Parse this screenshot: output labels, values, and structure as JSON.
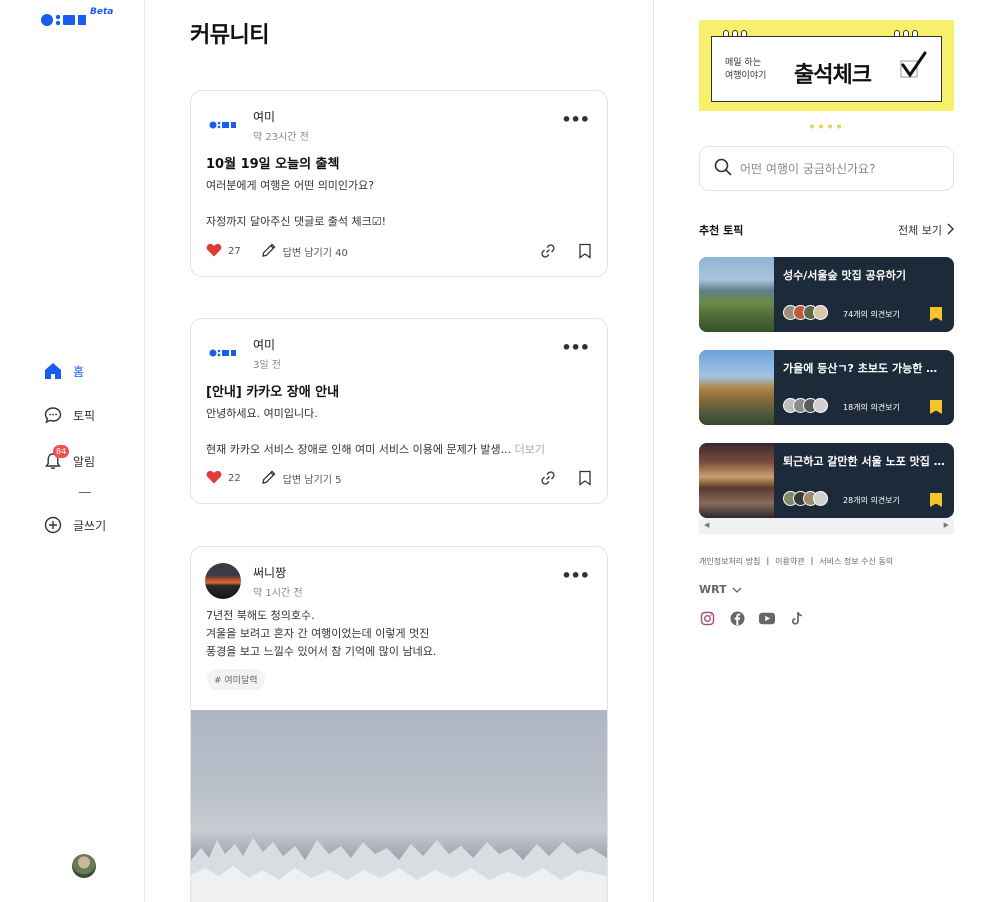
{
  "sidebar": {
    "logo_beta": "Beta",
    "items": [
      {
        "label": "홈",
        "icon": "home-icon"
      },
      {
        "label": "토픽",
        "icon": "chat-bubble-icon"
      },
      {
        "label": "알림",
        "icon": "bell-icon",
        "badge": "84"
      },
      {
        "label": "글쓰기",
        "icon": "plus-circle-icon"
      }
    ]
  },
  "main": {
    "title": "커뮤니티",
    "posts": [
      {
        "author": "여미",
        "time": "약 23시간 전",
        "title": "10월 19일 오늘의 출첵",
        "body": "여러분에게 여행은 어떤 의미인가요?\n\n자정까지 달아주신 댓글로 출석 체크☑!",
        "likes": "27",
        "reply_label": "답변 남기기 40"
      },
      {
        "author": "여미",
        "time": "3일 전",
        "title": "[안내] 카카오 장애 안내",
        "body": "안녕하세요. 여미입니다.\n\n현재 카카오 서비스 장애로 인해 여미 서비스 이용에 문제가 발생...",
        "more": " 더보기",
        "likes": "22",
        "reply_label": "답변 남기기 5"
      },
      {
        "author": "써니짱",
        "time": "약 1시간 전",
        "body": "7년전 북해도 청의호수.\n겨울을 보려고 혼자 간 여행이었는데 이렇게 멋진\n풍경을 보고 느낄수 있어서 참 기억에 많이 남네요.",
        "tag": "# 여미달력"
      }
    ]
  },
  "right": {
    "banner": {
      "small_line1": "매일 하는",
      "small_line2": "여행이야기",
      "big": "출석체크"
    },
    "search": {
      "placeholder": "어떤 여행이 궁금하신가요?"
    },
    "topics_title": "추천 토픽",
    "see_all": "전체 보기",
    "topics": [
      {
        "title": "성수/서울숲 맛집 공유하기",
        "count": "74개의 의견보기"
      },
      {
        "title": "가을에 등산ㄱ? 초보도 가능한 서울 근교 등산 코스",
        "count": "18개의 의견보기"
      },
      {
        "title": "퇴근하고 갈만한 서울 노포 맛집 추천해주세요",
        "count": "28개의 의견보기"
      }
    ],
    "footer_links": [
      "개인정보처리 방침",
      "이용약관",
      "서비스 정보 수신 동의"
    ],
    "lang": "WRT",
    "socials": [
      "instagram-icon",
      "facebook-icon",
      "youtube-icon",
      "tiktok-icon"
    ]
  },
  "colors": {
    "accent": "#1a5cf0",
    "heart": "#e03b3b",
    "bookmark": "#f6c42a",
    "banner": "#f6f06c",
    "topic_bg": "#1d2a3a"
  }
}
